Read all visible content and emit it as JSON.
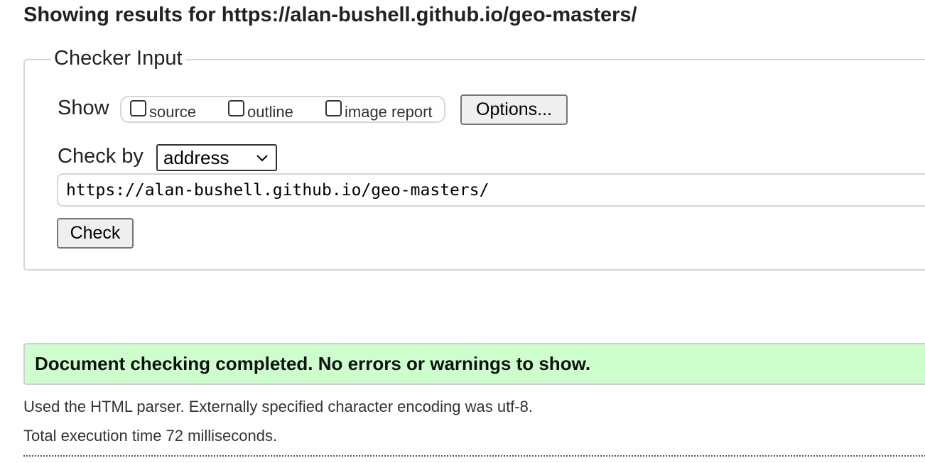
{
  "page": {
    "title": "Showing results for https://alan-bushell.github.io/geo-masters/"
  },
  "checker": {
    "legend": "Checker Input",
    "show_label": "Show",
    "show_options": [
      {
        "label": "source",
        "checked": false
      },
      {
        "label": "outline",
        "checked": false
      },
      {
        "label": "image report",
        "checked": false
      }
    ],
    "options_button": "Options...",
    "check_by_label": "Check by",
    "check_by_selected": "address",
    "url_value": "https://alan-bushell.github.io/geo-masters/",
    "check_button": "Check"
  },
  "results": {
    "status_message": "Document checking completed. No errors or warnings to show.",
    "status_color": "#ccffcc",
    "parser_info": "Used the HTML parser. Externally specified character encoding was utf-8.",
    "execution_time": "Total execution time 72 milliseconds."
  },
  "icons": {
    "select_arrow": "chevron-down-icon"
  }
}
